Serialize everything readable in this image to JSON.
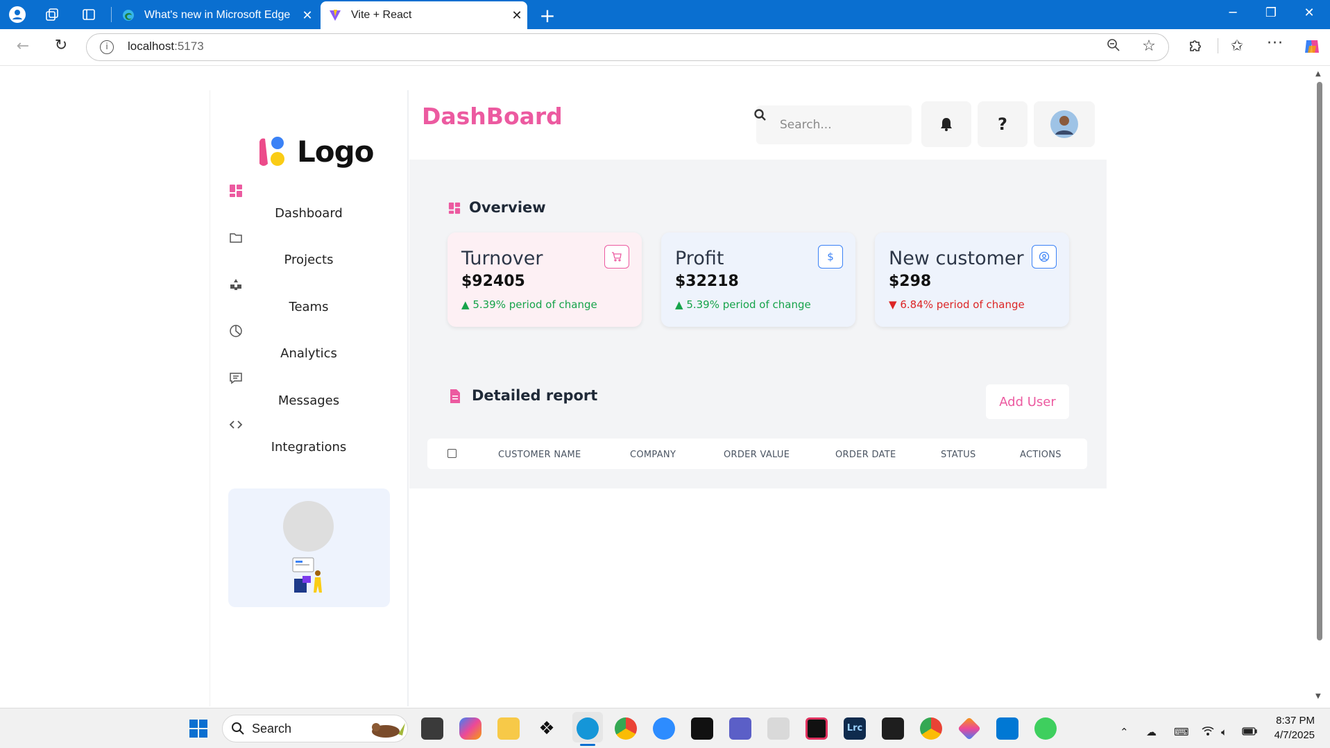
{
  "browser": {
    "tabs": [
      {
        "title": "What's new in Microsoft Edge",
        "active": false
      },
      {
        "title": "Vite + React",
        "active": true
      }
    ],
    "url_host": "localhost",
    "url_port": ":5173"
  },
  "sidebar": {
    "logo_text": "Logo",
    "items": [
      {
        "label": "Dashboard",
        "icon": "grid-icon",
        "active": true
      },
      {
        "label": "Projects",
        "icon": "folder-icon"
      },
      {
        "label": "Teams",
        "icon": "teams-icon"
      },
      {
        "label": "Analytics",
        "icon": "pie-chart-icon"
      },
      {
        "label": "Messages",
        "icon": "message-icon"
      },
      {
        "label": "Integrations",
        "icon": "code-icon"
      }
    ]
  },
  "header": {
    "title": "DashBoard",
    "search_placeholder": "Search...",
    "help_label": "?"
  },
  "overview": {
    "title": "Overview",
    "cards": [
      {
        "title": "Turnover",
        "value": "$92405",
        "change": "5.39% period of change",
        "direction": "up",
        "icon": "cart-icon",
        "bg": "#fdf0f4",
        "accent": "#ec5aa0"
      },
      {
        "title": "Profit",
        "value": "$32218",
        "change": "5.39% period of change",
        "direction": "up",
        "icon": "dollar-icon",
        "bg": "#eef3fc",
        "accent": "#3b82f6"
      },
      {
        "title": "New customer",
        "value": "$298",
        "change": "6.84% period of change",
        "direction": "down",
        "icon": "user-circle-icon",
        "bg": "#eef3fc",
        "accent": "#3b82f6"
      }
    ]
  },
  "report": {
    "title": "Detailed report",
    "add_user_label": "Add User",
    "columns": [
      "CUSTOMER NAME",
      "COMPANY",
      "ORDER VALUE",
      "ORDER DATE",
      "STATUS",
      "ACTIONS"
    ]
  },
  "colors": {
    "brand_pink": "#ec5aa0",
    "up_green": "#16a34a",
    "down_red": "#dc2626",
    "titlebar_blue": "#0a6fd0"
  },
  "taskbar": {
    "search_label": "Search",
    "time": "8:37 PM",
    "date": "4/7/2025"
  }
}
